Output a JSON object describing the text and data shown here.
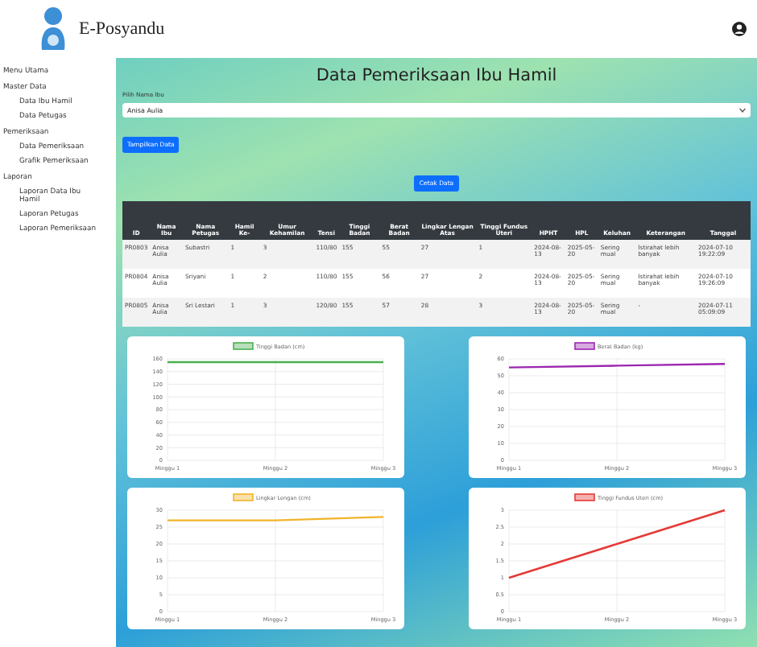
{
  "app": {
    "title": "E-Posyandu"
  },
  "sidebar": {
    "items": [
      {
        "label": "Menu Utama"
      },
      {
        "label": "Master Data",
        "children": [
          {
            "label": "Data Ibu Hamil"
          },
          {
            "label": "Data Petugas"
          }
        ]
      },
      {
        "label": "Pemeriksaan",
        "children": [
          {
            "label": "Data Pemeriksaan"
          },
          {
            "label": "Grafik Pemeriksaan"
          }
        ]
      },
      {
        "label": "Laporan",
        "children": [
          {
            "label": "Laporan Data Ibu Hamil"
          },
          {
            "label": "Laporan Petugas"
          },
          {
            "label": "Laporan Pemeriksaan"
          }
        ]
      }
    ]
  },
  "page": {
    "title": "Data Pemeriksaan Ibu Hamil",
    "select_label": "Pilih Nama Ibu",
    "select_value": "Anisa Aulia",
    "show_button": "Tampilkan Data",
    "print_button": "Cetak Data"
  },
  "table": {
    "columns": [
      "ID",
      "Nama Ibu",
      "Nama Petugas",
      "Hamil Ke-",
      "Umur Kehamilan",
      "Tensi",
      "Tinggi Badan",
      "Berat Badan",
      "Lingkar Lengan Atas",
      "Tinggi Fundus Uteri",
      "HPHT",
      "HPL",
      "Keluhan",
      "Keterangan",
      "Tanggal"
    ],
    "rows": [
      [
        "PR0803",
        "Anisa Aulia",
        "Subastri",
        "1",
        "3",
        "110/80",
        "155",
        "55",
        "27",
        "1",
        "2024-08-13",
        "2025-05-20",
        "Sering mual",
        "Istirahat lebih banyak",
        "2024-07-10 19:22:09"
      ],
      [
        "PR0804",
        "Anisa Aulia",
        "Sriyani",
        "1",
        "2",
        "110/80",
        "155",
        "56",
        "27",
        "2",
        "2024-08-13",
        "2025-05-20",
        "Sering mual",
        "Istirahat lebih banyak",
        "2024-07-10 19:26:09"
      ],
      [
        "PR0805",
        "Anisa Aulia",
        "Sri Lestari",
        "1",
        "3",
        "120/80",
        "155",
        "57",
        "28",
        "3",
        "2024-08-13",
        "2025-05-20",
        "Sering mual",
        "-",
        "2024-07-11 05:09:09"
      ]
    ]
  },
  "charts": [
    {
      "chart_data": {
        "type": "line",
        "categories": [
          "Minggu 1",
          "Minggu 2",
          "Minggu 3"
        ],
        "grid": true,
        "ylim": [
          0,
          160
        ],
        "yticks": [
          0,
          20,
          40,
          60,
          80,
          100,
          120,
          140,
          160
        ],
        "series": [
          {
            "name": "Tinggi Badan (cm)",
            "color": "#4caf50",
            "values": [
              155,
              155,
              155
            ]
          }
        ]
      }
    },
    {
      "chart_data": {
        "type": "line",
        "categories": [
          "Minggu 1",
          "Minggu 2",
          "Minggu 3"
        ],
        "grid": true,
        "ylim": [
          0,
          60
        ],
        "yticks": [
          0,
          10,
          20,
          30,
          40,
          50,
          60
        ],
        "series": [
          {
            "name": "Berat Badan (kg)",
            "color": "#9c27b0",
            "values": [
              55,
              56,
              57
            ]
          }
        ]
      }
    },
    {
      "chart_data": {
        "type": "line",
        "categories": [
          "Minggu 1",
          "Minggu 2",
          "Minggu 3"
        ],
        "grid": true,
        "ylim": [
          0,
          30
        ],
        "yticks": [
          0,
          5,
          10,
          15,
          20,
          25,
          30
        ],
        "series": [
          {
            "name": "Lingkar Lengan (cm)",
            "color": "#f0b429",
            "values": [
              27,
              27,
              28
            ]
          }
        ]
      }
    },
    {
      "chart_data": {
        "type": "line",
        "categories": [
          "Minggu 1",
          "Minggu 2",
          "Minggu 3"
        ],
        "grid": true,
        "ylim": [
          0,
          3
        ],
        "yticks": [
          0,
          0.5,
          1,
          1.5,
          2,
          2.5,
          3
        ],
        "series": [
          {
            "name": "Tinggi Fundus Uteri (cm)",
            "color": "#e53935",
            "values": [
              1,
              2,
              3
            ]
          }
        ]
      }
    }
  ]
}
